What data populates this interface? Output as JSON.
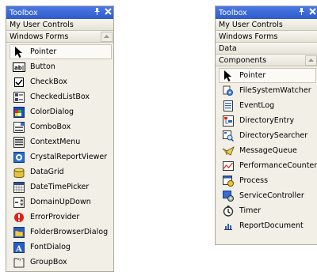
{
  "left_toolbox": {
    "title": "Toolbox",
    "pin_glyph": "❖",
    "close_glyph": "✕",
    "tabs": [
      {
        "label": "My User Controls"
      },
      {
        "label": "Windows Forms"
      }
    ],
    "items": [
      {
        "label": "Pointer",
        "icon": "pointer-icon",
        "selected": true
      },
      {
        "label": "Button",
        "icon": "button-icon"
      },
      {
        "label": "CheckBox",
        "icon": "checkbox-icon"
      },
      {
        "label": "CheckedListBox",
        "icon": "checkedlistbox-icon"
      },
      {
        "label": "ColorDialog",
        "icon": "colordialog-icon"
      },
      {
        "label": "ComboBox",
        "icon": "combobox-icon"
      },
      {
        "label": "ContextMenu",
        "icon": "contextmenu-icon"
      },
      {
        "label": "CrystalReportViewer",
        "icon": "crystalreportviewer-icon"
      },
      {
        "label": "DataGrid",
        "icon": "datagrid-icon"
      },
      {
        "label": "DateTimePicker",
        "icon": "datetimepicker-icon"
      },
      {
        "label": "DomainUpDown",
        "icon": "domainupdown-icon"
      },
      {
        "label": "ErrorProvider",
        "icon": "errorprovider-icon"
      },
      {
        "label": "FolderBrowserDialog",
        "icon": "folderbrowserdialog-icon"
      },
      {
        "label": "FontDialog",
        "icon": "fontdialog-icon"
      },
      {
        "label": "GroupBox",
        "icon": "groupbox-icon"
      }
    ]
  },
  "right_toolbox": {
    "title": "Toolbox",
    "pin_glyph": "❖",
    "close_glyph": "✕",
    "tabs": [
      {
        "label": "My User Controls"
      },
      {
        "label": "Windows Forms"
      },
      {
        "label": "Data"
      },
      {
        "label": "Components"
      }
    ],
    "items": [
      {
        "label": "Pointer",
        "icon": "pointer-icon",
        "selected": true
      },
      {
        "label": "FileSystemWatcher",
        "icon": "filesystemwatcher-icon"
      },
      {
        "label": "EventLog",
        "icon": "eventlog-icon"
      },
      {
        "label": "DirectoryEntry",
        "icon": "directoryentry-icon"
      },
      {
        "label": "DirectorySearcher",
        "icon": "directorysearcher-icon"
      },
      {
        "label": "MessageQueue",
        "icon": "messagequeue-icon"
      },
      {
        "label": "PerformanceCounter",
        "icon": "performancecounter-icon"
      },
      {
        "label": "Process",
        "icon": "process-icon"
      },
      {
        "label": "ServiceController",
        "icon": "servicecontroller-icon"
      },
      {
        "label": "Timer",
        "icon": "timer-icon"
      },
      {
        "label": "ReportDocument",
        "icon": "reportdocument-icon"
      }
    ]
  },
  "colors": {
    "titlebar": "#3e6ad8",
    "panel": "#f1efe6",
    "border": "#aca899"
  }
}
